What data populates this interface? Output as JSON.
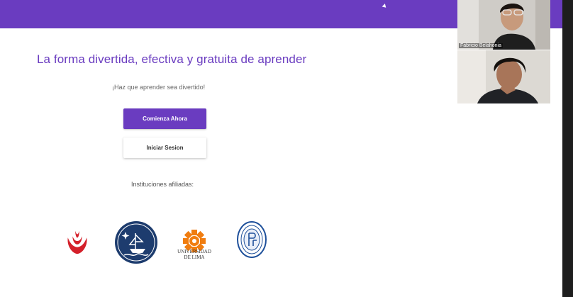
{
  "header": {
    "color": "#6a3cc0"
  },
  "hero": {
    "headline": "La forma divertida, efectiva y gratuita de aprender",
    "tagline": "¡Haz que aprender sea divertido!"
  },
  "actions": {
    "start_label": "Comienza Ahora",
    "login_label": "Iniciar Sesion"
  },
  "affiliates": {
    "label": "Instituciones afiliadas:",
    "logos": [
      "upc-logo",
      "navy-school-logo",
      "universidad-de-lima-logo",
      "universidad-del-pacifico-logo"
    ],
    "lima_text_line1": "UNIVERSIDAD",
    "lima_text_line2": "DE LIMA"
  },
  "video_call": {
    "participants": [
      {
        "name": "Fabricio Belahonia"
      },
      {
        "name": ""
      }
    ]
  }
}
